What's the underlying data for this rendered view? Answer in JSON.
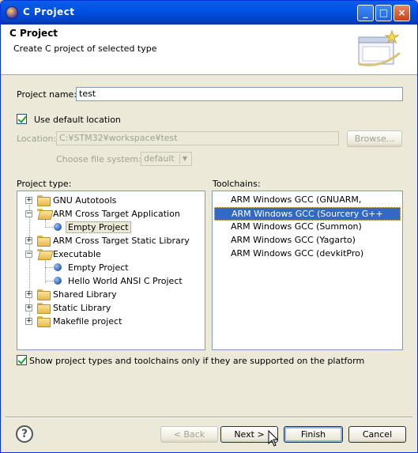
{
  "window": {
    "title": "C Project"
  },
  "header": {
    "title": "C Project",
    "description": "Create C project of selected type"
  },
  "project_name": {
    "label": "Project name:",
    "value": "test"
  },
  "default_location": {
    "label": "Use default location",
    "checked": true
  },
  "location": {
    "label": "Location:",
    "value": "C:¥STM32¥workspace¥test",
    "browse_label": "Browse..."
  },
  "file_system": {
    "label": "Choose file system:",
    "value": "default"
  },
  "project_type": {
    "label": "Project type:",
    "items": [
      {
        "label": "GNU Autotools",
        "kind": "folder",
        "expanded": false
      },
      {
        "label": "ARM Cross Target Application",
        "kind": "folder",
        "expanded": true
      },
      {
        "label": "Empty Project",
        "kind": "leaf",
        "selected": true
      },
      {
        "label": "ARM Cross Target Static Library",
        "kind": "folder",
        "expanded": false
      },
      {
        "label": "Executable",
        "kind": "folder",
        "expanded": true
      },
      {
        "label": "Empty Project",
        "kind": "leaf"
      },
      {
        "label": "Hello World ANSI C Project",
        "kind": "leaf"
      },
      {
        "label": "Shared Library",
        "kind": "folder",
        "expanded": false
      },
      {
        "label": "Static Library",
        "kind": "folder",
        "expanded": false
      },
      {
        "label": "Makefile project",
        "kind": "folder",
        "expanded": false
      }
    ]
  },
  "toolchains": {
    "label": "Toolchains:",
    "items": [
      {
        "label": "ARM Windows GCC (GNUARM, WinARM)"
      },
      {
        "label": "ARM Windows GCC (Sourcery G++ Lite)",
        "selected": true
      },
      {
        "label": "ARM Windows GCC (Summon)"
      },
      {
        "label": "ARM Windows GCC (Yagarto)"
      },
      {
        "label": "ARM Windows GCC (devkitPro)"
      }
    ]
  },
  "filter": {
    "label": "Show project types and toolchains only if they are supported on the platform",
    "checked": true
  },
  "buttons": {
    "back": "< Back",
    "next": "Next >",
    "finish": "Finish",
    "cancel": "Cancel"
  },
  "icons": {
    "app": "eclipse-icon",
    "help": "help-icon",
    "banner": "new-project-wizard-banner-icon"
  }
}
